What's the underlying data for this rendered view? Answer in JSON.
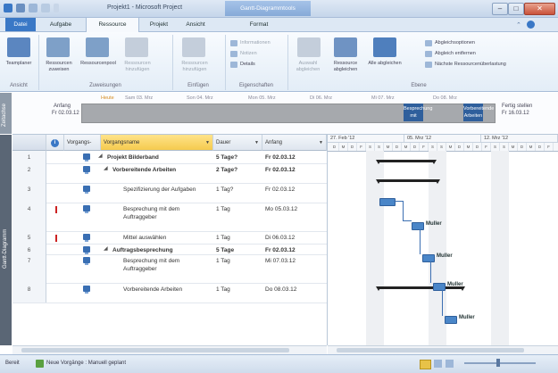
{
  "app": {
    "title": "Projekt1 - Microsoft Project",
    "context_tab": "Gantt-Diagrammtools"
  },
  "tabs": [
    {
      "label": "Datei"
    },
    {
      "label": "Aufgabe"
    },
    {
      "label": "Ressource"
    },
    {
      "label": "Projekt"
    },
    {
      "label": "Ansicht"
    },
    {
      "label": "Format"
    }
  ],
  "ribbon": {
    "groups": [
      {
        "label": "Ansicht"
      },
      {
        "label": "Zuweisungen"
      },
      {
        "label": "Einfügen"
      },
      {
        "label": "Eigenschaften"
      },
      {
        "label": "Ebene"
      }
    ],
    "buttons": {
      "team_planner": "Teamplaner",
      "assign_resources": "Ressourcen zuweisen",
      "resource_pool": "Ressourcenpool",
      "add_resources": "Ressourcen hinzufügen",
      "new_resource": "Ressourcen hinzufügen",
      "information": "Informationen",
      "notes": "Notizen",
      "details": "Details",
      "level_selection": "Auswahl abgleichen",
      "level_resource": "Ressource abgleichen",
      "level_all": "Alle abgleichen",
      "leveling_options": "Abgleichsoptionen",
      "clear_leveling": "Abgleich entfernen",
      "next_overallocation": "Nächste Ressourcenüberlastung"
    }
  },
  "timeline": {
    "side_label": "Zeitachse",
    "today": "Heute",
    "start_label": "Anfang",
    "start_date": "Fr 02.03.12",
    "finish_label": "Fertig stellen",
    "finish_date": "Fr 16.03.12",
    "dates": [
      "Sam 03. Mrz",
      "Son 04. Mrz",
      "Mon 05. Mrz",
      "Di 06. Mrz",
      "Mi 07. Mrz",
      "Do 08. Mrz"
    ],
    "items": [
      {
        "label": "Besprechung mit"
      },
      {
        "label": "Vorbereitende Arbeiten"
      }
    ]
  },
  "sheet": {
    "side_label": "Gantt-Diagramm",
    "headers": {
      "info_icon": "i",
      "mode": "Vorgangs-",
      "name": "Vorgangsname",
      "duration": "Dauer",
      "start": "Anfang"
    },
    "rows": [
      {
        "num": "1",
        "name": "Projekt Bilderband",
        "duration": "5 Tage?",
        "start": "Fr 02.03.12",
        "bold": true,
        "indent": 0
      },
      {
        "num": "2",
        "name": "Vorbereitende Arbeiten",
        "duration": "2 Tage?",
        "start": "Fr 02.03.12",
        "bold": true,
        "indent": 1
      },
      {
        "num": "3",
        "name": "Spezifizierung der Aufgaben",
        "duration": "1 Tag?",
        "start": "Fr 02.03.12",
        "bold": false,
        "indent": 2
      },
      {
        "num": "4",
        "name": "Besprechung mit dem Auftraggeber",
        "duration": "1 Tag",
        "start": "Mo 05.03.12",
        "bold": false,
        "indent": 2
      },
      {
        "num": "5",
        "name": "Mittel auswählen",
        "duration": "1 Tag",
        "start": "Di 06.03.12",
        "bold": false,
        "indent": 2
      },
      {
        "num": "6",
        "name": "Auftragsbesprechung",
        "duration": "5 Tage",
        "start": "Fr 02.03.12",
        "bold": true,
        "indent": 1
      },
      {
        "num": "7",
        "name": "Besprechung mit dem Auftraggeber",
        "duration": "1 Tag",
        "start": "Mi 07.03.12",
        "bold": false,
        "indent": 2
      },
      {
        "num": "8",
        "name": "Vorbereitende Arbeiten",
        "duration": "1 Tag",
        "start": "Do 08.03.12",
        "bold": false,
        "indent": 2
      }
    ]
  },
  "gantt": {
    "weeks": [
      "27. Feb '12",
      "05. Mrz '12",
      "12. Mrz '12"
    ],
    "days": [
      "D",
      "M",
      "D",
      "F",
      "S",
      "S",
      "M",
      "D",
      "M",
      "D",
      "F",
      "S",
      "S",
      "M",
      "D",
      "M",
      "D",
      "F",
      "S",
      "S",
      "M",
      "D",
      "M",
      "D",
      "F"
    ],
    "resources": [
      "Muller",
      "Muller",
      "Muller",
      "Muller"
    ]
  },
  "status": {
    "ready": "Bereit",
    "mode": "Neue Vorgänge : Manuell geplant"
  }
}
